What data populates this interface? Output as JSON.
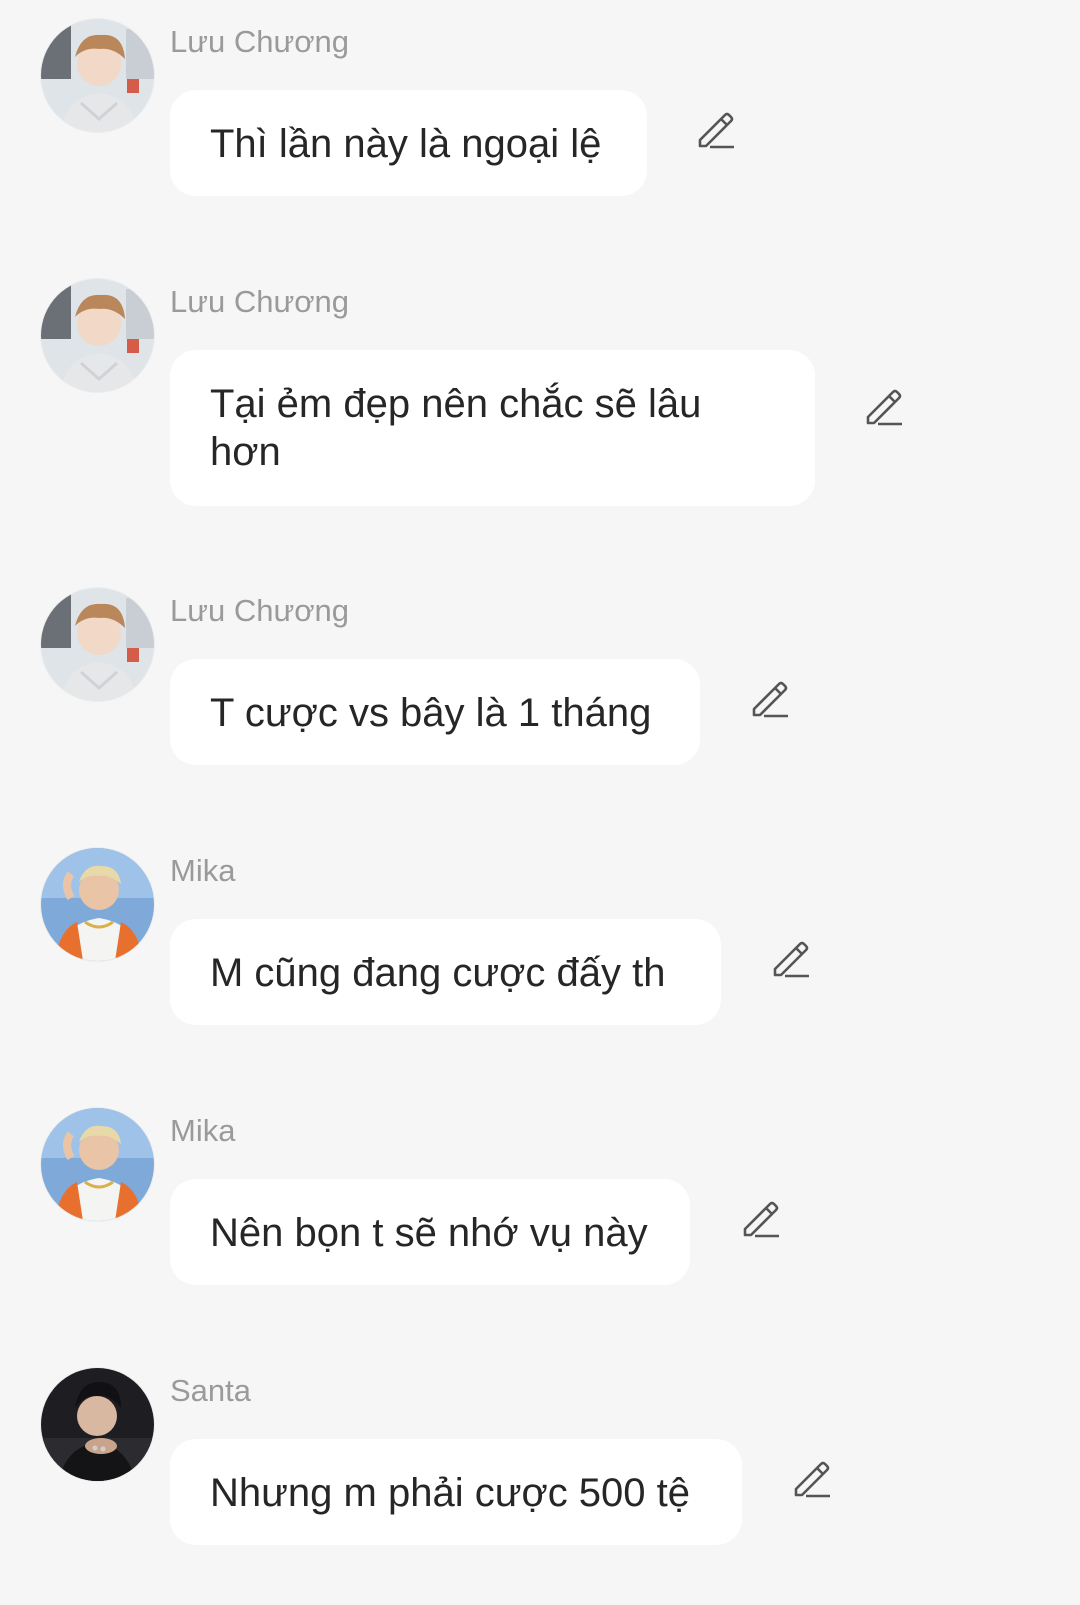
{
  "messages": [
    {
      "sender": "Lưu Chương",
      "text": "Thì lần này là ngoại lệ",
      "avatar_icon": "user-avatar-luu-chuong"
    },
    {
      "sender": "Lưu Chương",
      "text": "Tại ẻm đẹp nên chắc sẽ lâu hơn",
      "avatar_icon": "user-avatar-luu-chuong"
    },
    {
      "sender": "Lưu Chương",
      "text": "T cược vs bây là 1 tháng",
      "avatar_icon": "user-avatar-luu-chuong"
    },
    {
      "sender": "Mika",
      "text": "M cũng đang cược đấy th",
      "avatar_icon": "user-avatar-mika"
    },
    {
      "sender": "Mika",
      "text": "Nên bọn t sẽ nhớ vụ này",
      "avatar_icon": "user-avatar-mika"
    },
    {
      "sender": "Santa",
      "text": "Nhưng m phải cược 500 tệ",
      "avatar_icon": "user-avatar-santa"
    }
  ],
  "edit_icon": "pencil-edit-icon",
  "colors": {
    "background": "#f6f6f6",
    "bubble": "#ffffff",
    "sender_text": "#9a9a9a",
    "message_text": "#262626",
    "icon_stroke": "#555555"
  }
}
